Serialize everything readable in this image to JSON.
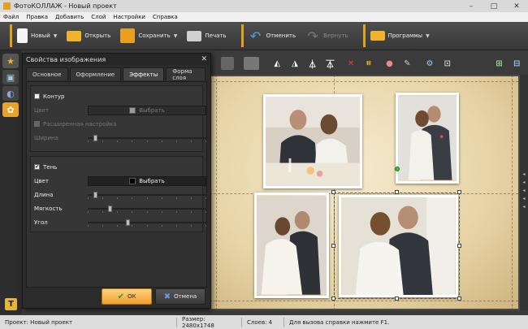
{
  "window": {
    "title": "ФотоКОЛЛАЖ - Новый проект"
  },
  "menu": [
    "Файл",
    "Правка",
    "Добавить",
    "Слой",
    "Настройки",
    "Справка"
  ],
  "toolbar": {
    "new": "Новый",
    "open": "Открыть",
    "save": "Сохранить",
    "print": "Печать",
    "undo": "Отменить",
    "redo": "Вернуть",
    "programs": "Программы"
  },
  "dialog": {
    "title": "Свойства изображения",
    "tabs": [
      "Основное",
      "Оформление",
      "Эффекты",
      "Форма слоя"
    ],
    "active_tab": "Эффекты",
    "contour": {
      "label": "Контур",
      "checked": false,
      "color_label": "Цвет",
      "color_button": "Выбрать",
      "color_hex": "#9a9a9a",
      "advanced_label": "Расширенная настройка",
      "width_label": "Ширина",
      "width_value": 0.05
    },
    "shadow": {
      "label": "Тень",
      "checked": true,
      "color_label": "Цвет",
      "color_button": "Выбрать",
      "color_hex": "#000000",
      "length_label": "Длина",
      "length_value": 0.05,
      "softness_label": "Мягкость",
      "softness_value": 0.18,
      "angle_label": "Угол",
      "angle_value": 0.33
    },
    "ok": "ОК",
    "cancel": "Отмена"
  },
  "statusbar": {
    "project": "Проект: Новый проект",
    "size": "Размер: 2480x1748",
    "layers": "Слоев: 4",
    "help": "Для вызова справки нажмите F1."
  },
  "colors": {
    "accent": "#e3a21a",
    "ok": "#f0a030"
  }
}
